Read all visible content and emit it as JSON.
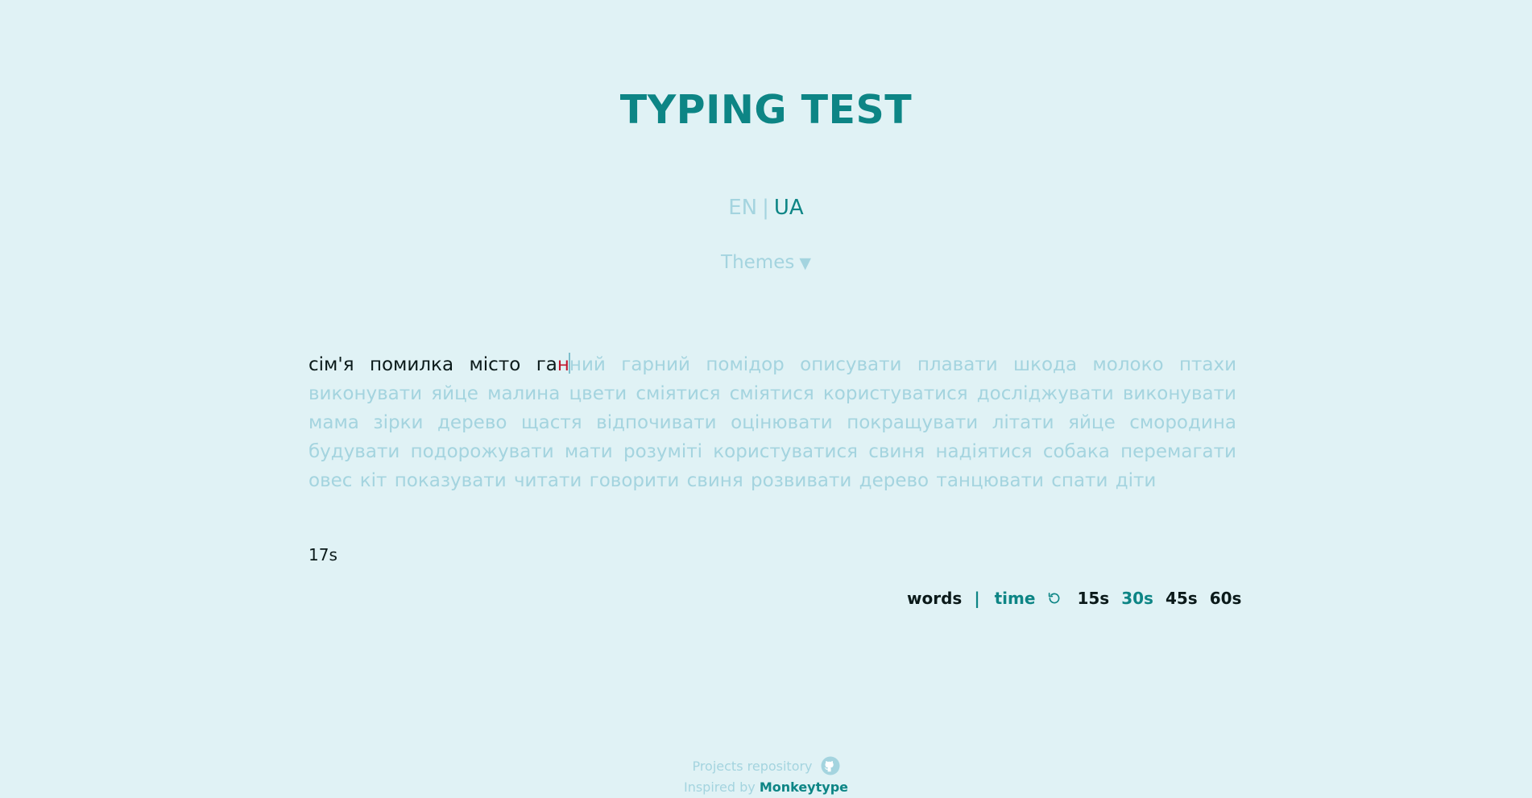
{
  "header": {
    "title": "TYPING TEST"
  },
  "language": {
    "options": [
      "EN",
      "UA"
    ],
    "separator": "|",
    "selected": "UA"
  },
  "themes": {
    "label": "Themes",
    "arrow": "▼"
  },
  "test": {
    "typed_words": [
      "сім'я",
      "помилка",
      "місто"
    ],
    "current_word_correct": "га",
    "current_word_wrong": "н",
    "current_word_rest": "ний",
    "upcoming_text": "гарний помідор описувати плавати шкода молоко птахи виконувати яйце малина цвети сміятися сміятися користуватися досліджувати виконувати мама зірки дерево щастя відпочивати оцінювати покращувати літати яйце смородина будувати подорожувати мати розуміті користуватися свиня надіятися собака перемагати овес кіт показувати читати говорити свиня розвивати дерево танцювати спати діти",
    "timer": "17s"
  },
  "modes": {
    "words_label": "words",
    "separator": "|",
    "time_label": "time",
    "restart_icon": "restart-icon",
    "durations": [
      "15s",
      "30s",
      "45s",
      "60s"
    ],
    "selected_mode": "time",
    "selected_duration": "30s"
  },
  "footer": {
    "repo_label": "Projects repository",
    "repo_icon": "github-icon",
    "inspired_prefix": "Inspired by",
    "inspired_link": "Monkeytype"
  },
  "colors": {
    "background": "#e0f2f5",
    "accent": "#0d8585",
    "muted": "#a4d4df",
    "text": "#0b1a1a",
    "error": "#c0142c"
  }
}
